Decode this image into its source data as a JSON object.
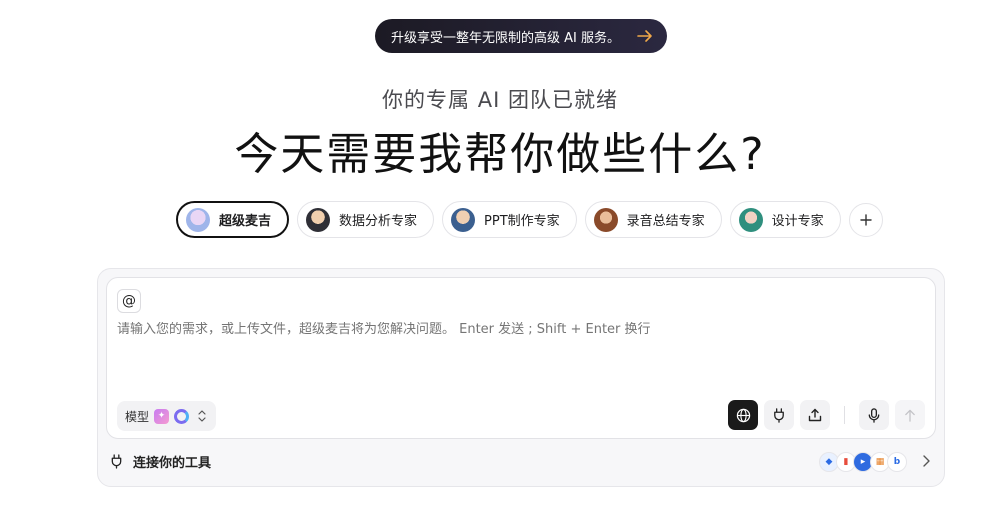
{
  "promo": {
    "text": "升级享受一整年无限制的高级 AI 服务。",
    "arrow_icon": "arrow-right-icon",
    "arrow_color": "#f0a94a"
  },
  "hero": {
    "subtitle": "你的专属 AI 团队已就绪",
    "headline": "今天需要我帮你做些什么?"
  },
  "agents": [
    {
      "label": "超级麦吉",
      "active": true
    },
    {
      "label": "数据分析专家",
      "active": false
    },
    {
      "label": "PPT制作专家",
      "active": false
    },
    {
      "label": "录音总结专家",
      "active": false
    },
    {
      "label": "设计专家",
      "active": false
    }
  ],
  "composer": {
    "at_label": "@",
    "placeholder": "请输入您的需求，或上传文件，超级麦吉将为您解决问题。 Enter 发送 ; Shift + Enter 换行",
    "model_label": "模型",
    "tools": [
      "globe-icon",
      "plug-icon",
      "upload-icon",
      "mic-icon",
      "arrow-up-icon"
    ]
  },
  "connect": {
    "label": "连接你的工具",
    "logos": [
      "b"
    ]
  }
}
